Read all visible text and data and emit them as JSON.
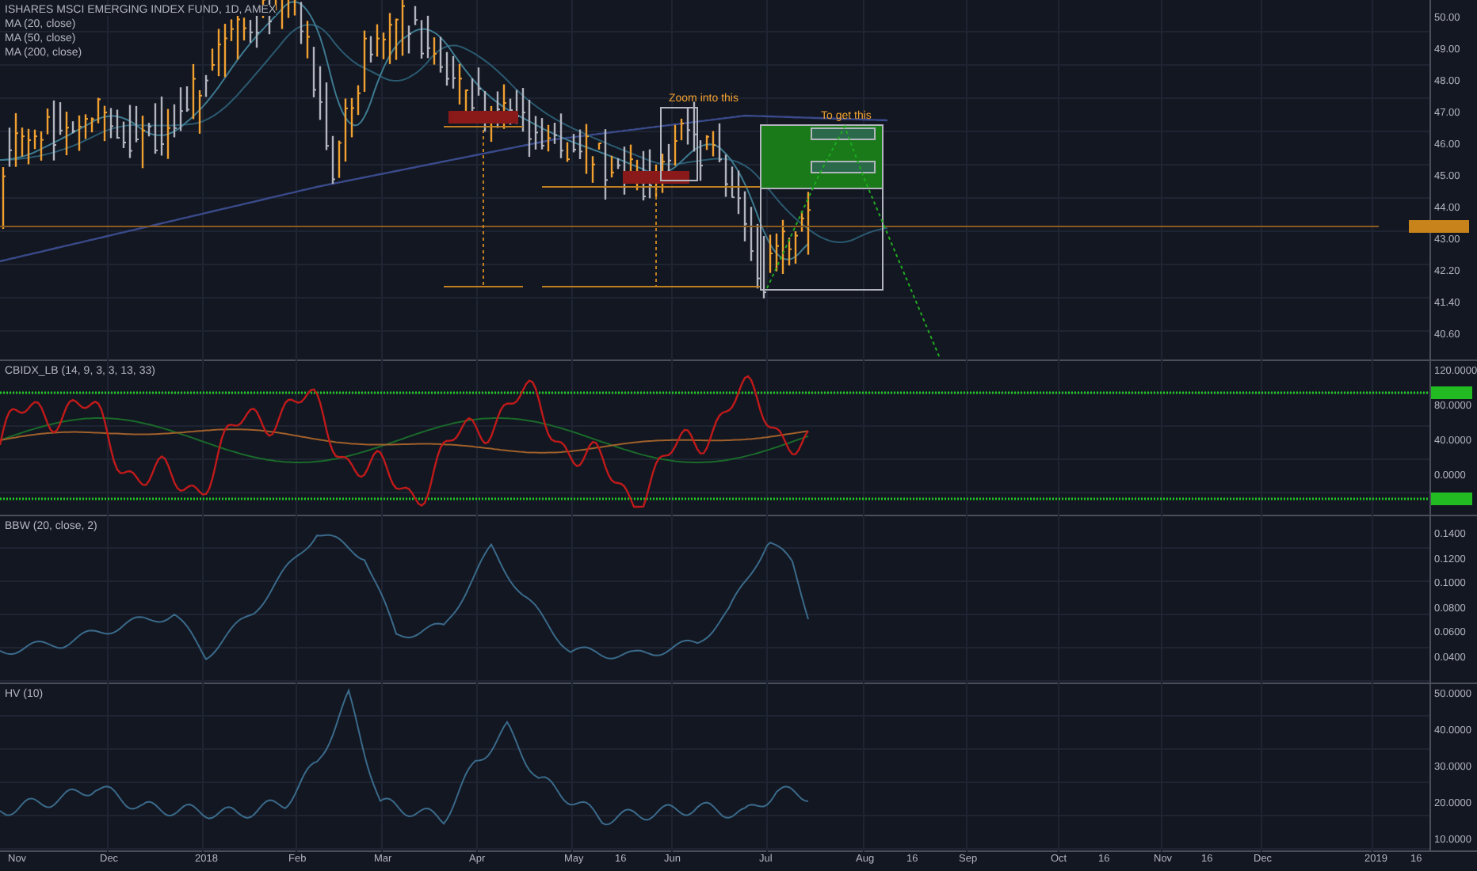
{
  "price_pane": {
    "title": "ISHARES MSCI EMERGING INDEX FUND, 1D, AMEX",
    "studies": [
      "MA (20, close)",
      "MA (50, close)",
      "MA (200, close)"
    ],
    "notes": [
      "Zoom into this",
      "To get this"
    ],
    "scale": [
      "50.00",
      "49.00",
      "48.00",
      "47.00",
      "46.00",
      "45.00",
      "44.00",
      "43.00",
      "42.20",
      "41.40",
      "40.60"
    ]
  },
  "oscillator_pane": {
    "title": "CBIDX_LB (14, 9, 3, 3, 13, 33)",
    "scale": [
      "120.0000",
      "80.0000",
      "40.0000",
      "0.0000"
    ]
  },
  "bbw_pane": {
    "title": "BBW (20, close, 2)",
    "scale": [
      "0.1400",
      "0.1200",
      "0.1000",
      "0.0800",
      "0.0600",
      "0.0400"
    ]
  },
  "hv_pane": {
    "title": "HV (10)",
    "scale": [
      "50.0000",
      "40.0000",
      "30.0000",
      "20.0000",
      "10.0000"
    ]
  },
  "time_axis": [
    "Nov",
    "Dec",
    "2018",
    "Feb",
    "Mar",
    "Apr",
    "May",
    "16",
    "Jun",
    "Jul",
    "Aug",
    "16",
    "Sep",
    "Oct",
    "16",
    "Nov",
    "16",
    "Dec",
    "2019",
    "16"
  ]
}
